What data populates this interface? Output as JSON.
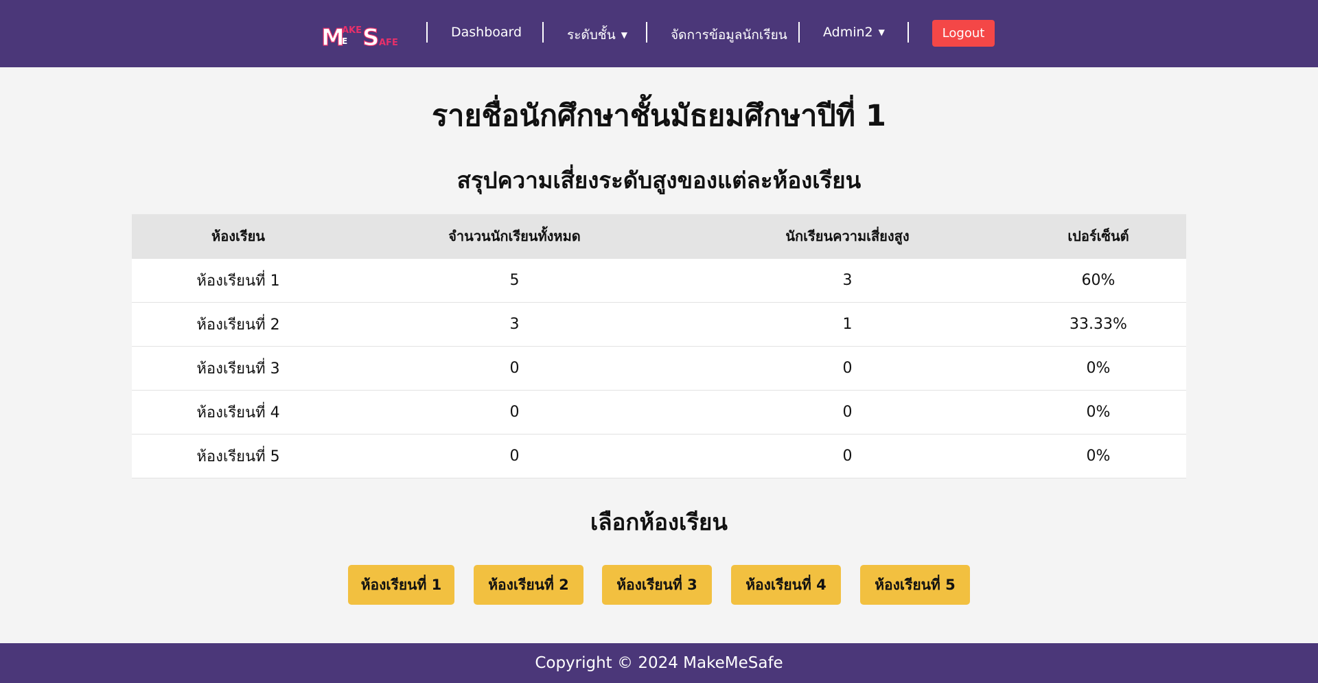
{
  "nav": {
    "logo_text": "MakeMeSafe",
    "dashboard": "Dashboard",
    "level": "ระดับชั้น",
    "manage_students": "จัดการข้อมูลนักเรียน",
    "admin": "Admin2",
    "logout": "Logout",
    "caret_icon": "caret-down-icon"
  },
  "page_title": "รายชื่อนักศึกษาชั้นมัธยมศึกษาปีที่ 1",
  "summary": {
    "title": "สรุปความเสี่ยงระดับสูงของแต่ละห้องเรียน",
    "headers": [
      "ห้องเรียน",
      "จำนวนนักเรียนทั้งหมด",
      "นักเรียนความเสี่ยงสูง",
      "เปอร์เซ็นต์"
    ],
    "rows": [
      [
        "ห้องเรียนที่ 1",
        "5",
        "3",
        "60%"
      ],
      [
        "ห้องเรียนที่ 2",
        "3",
        "1",
        "33.33%"
      ],
      [
        "ห้องเรียนที่ 3",
        "0",
        "0",
        "0%"
      ],
      [
        "ห้องเรียนที่ 4",
        "0",
        "0",
        "0%"
      ],
      [
        "ห้องเรียนที่ 5",
        "0",
        "0",
        "0%"
      ]
    ]
  },
  "select": {
    "title": "เลือกห้องเรียน",
    "buttons": [
      "ห้องเรียนที่ 1",
      "ห้องเรียนที่ 2",
      "ห้องเรียนที่ 3",
      "ห้องเรียนที่ 4",
      "ห้องเรียนที่ 5"
    ]
  },
  "footer": {
    "copyright": "Copyright © 2024 MakeMeSafe"
  },
  "colors": {
    "nav_bg": "#4b3779",
    "logout_bg": "#f44747",
    "class_button_bg": "#f2c040",
    "logo_pink": "#e8306a",
    "page_bg": "#f4f4f4"
  }
}
